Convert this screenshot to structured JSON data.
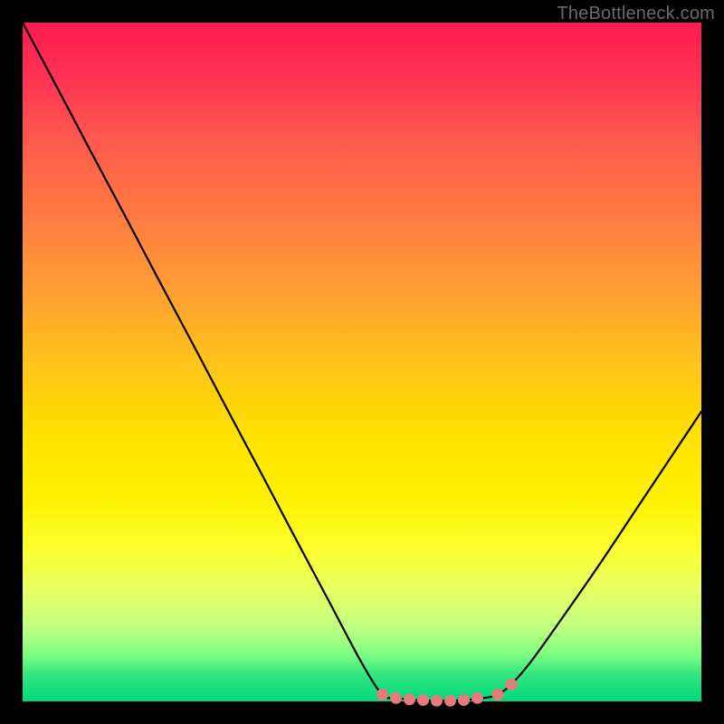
{
  "watermark": "TheBottleneck.com",
  "colors": {
    "background": "#000000",
    "gradient_top": "#ff1a4d",
    "gradient_bottom": "#00d97a",
    "curve_stroke": "#000000",
    "marker_fill": "#e77b7b",
    "marker_stroke": "#e77b7b"
  },
  "chart_data": {
    "type": "line",
    "title": "",
    "xlabel": "",
    "ylabel": "",
    "xlim": [
      0,
      100
    ],
    "ylim": [
      0,
      100
    ],
    "background": "vertical red→yellow→green gradient (heatmap strip)",
    "series": [
      {
        "name": "bottleneck-curve",
        "description": "V-shaped mismatch curve; minima (flat trough) around x≈53–70; left arm starts at top-left corner, right arm rises to ~43% height at x=100.",
        "x": [
          0,
          5,
          10,
          15,
          20,
          25,
          30,
          35,
          40,
          45,
          50,
          53,
          55,
          58,
          60,
          62,
          65,
          68,
          70,
          72,
          75,
          80,
          85,
          90,
          95,
          100
        ],
        "values": [
          100,
          90.6,
          81.1,
          71.7,
          62.2,
          52.8,
          43.3,
          33.9,
          24.4,
          15.0,
          5.6,
          1.0,
          0.5,
          0.2,
          0.1,
          0.1,
          0.2,
          0.5,
          1.0,
          2.5,
          6.0,
          13.0,
          20.2,
          27.7,
          35.2,
          42.7
        ]
      }
    ],
    "markers": {
      "name": "optimal-range-dots",
      "description": "Pink circles along the trough indicating the low-bottleneck band plus one slightly higher end marker.",
      "x": [
        53,
        55,
        57,
        59,
        61,
        63,
        65,
        67,
        70,
        72
      ],
      "values": [
        1.0,
        0.5,
        0.3,
        0.2,
        0.1,
        0.1,
        0.2,
        0.5,
        1.0,
        2.5
      ],
      "r": 6
    }
  }
}
